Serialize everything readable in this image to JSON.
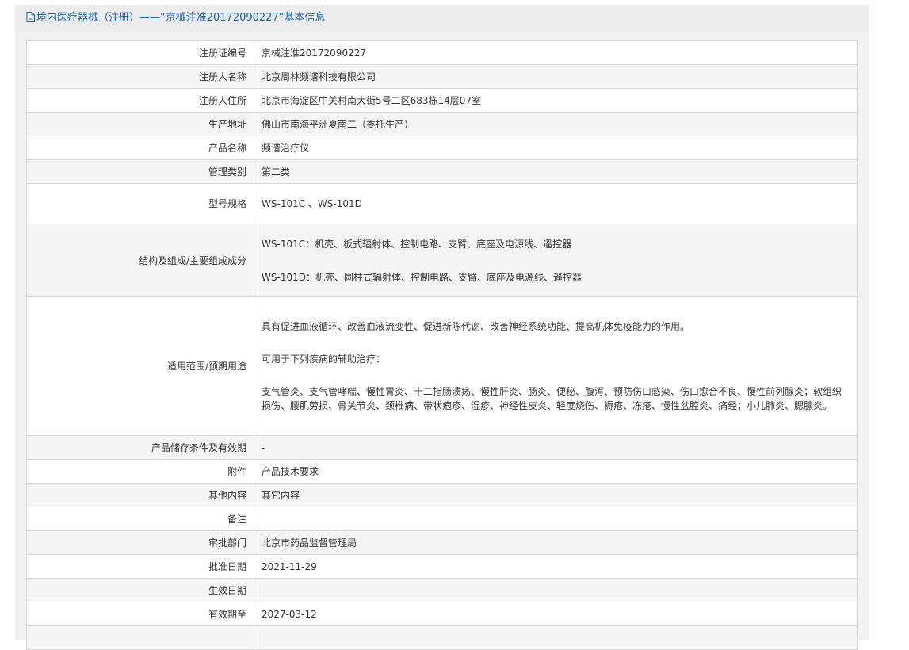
{
  "header": {
    "icon": "document-icon",
    "title": "境内医疗器械（注册）——“京械注准20172090227”基本信息"
  },
  "rows": {
    "reg_no": {
      "label": "注册证编号",
      "value": "京械注准20172090227"
    },
    "registrant_name": {
      "label": "注册人名称",
      "value": "北京周林频谱科技有限公司"
    },
    "registrant_address": {
      "label": "注册人住所",
      "value": "北京市海淀区中关村南大街5号二区683栋14层07室"
    },
    "production_address": {
      "label": "生产地址",
      "value": "佛山市南海平洲夏南二（委托生产）"
    },
    "product_name": {
      "label": "产品名称",
      "value": "频谱治疗仪"
    },
    "management_class": {
      "label": "管理类别",
      "value": "第二类"
    },
    "model_spec": {
      "label": "型号规格",
      "value": "WS-101C 、WS-101D"
    },
    "structure": {
      "label": "结构及组成/主要组成成分",
      "line1": "WS-101C：机壳、板式辐射体、控制电路、支臂、底座及电源线、遥控器",
      "line2": "WS-101D：机壳、圆柱式辐射体、控制电路、支臂、底座及电源线、遥控器"
    },
    "scope": {
      "label": "适用范围/预期用途",
      "para1": "具有促进血液循环、改善血液流变性、促进新陈代谢、改善神经系统功能、提高机体免疫能力的作用。",
      "para2": "可用于下列疾病的辅助治疗：",
      "para3": "支气管炎、支气管哮喘、慢性胃炎、十二指肠溃疡、慢性肝炎、肠炎、便秘、腹泻、预防伤口感染、伤口愈合不良、慢性前列腺炎；软组织损伤、腰肌劳损、骨关节炎、颈椎病、带状疱疹、湿疹、神经性皮炎、轻度烧伤、褥疮、冻疮、慢性盆腔炎、痛经；小儿肺炎、腮腺炎。"
    },
    "storage": {
      "label": "产品储存条件及有效期",
      "value": "-"
    },
    "attachment": {
      "label": "附件",
      "value": "产品技术要求"
    },
    "other": {
      "label": "其他内容",
      "value": "其它内容"
    },
    "remarks": {
      "label": "备注",
      "value": ""
    },
    "approval_dept": {
      "label": "审批部门",
      "value": "北京市药品监督管理局"
    },
    "approval_date": {
      "label": "批准日期",
      "value": "2021-11-29"
    },
    "effective_date": {
      "label": "生效日期",
      "value": ""
    },
    "expiry_date": {
      "label": "有效期至",
      "value": "2027-03-12"
    }
  },
  "colors": {
    "header_text": "#1a63a9",
    "panel_bg": "#f1f1f1",
    "row_alt_bg": "#f5f5f5",
    "border": "#d7d7d7"
  }
}
